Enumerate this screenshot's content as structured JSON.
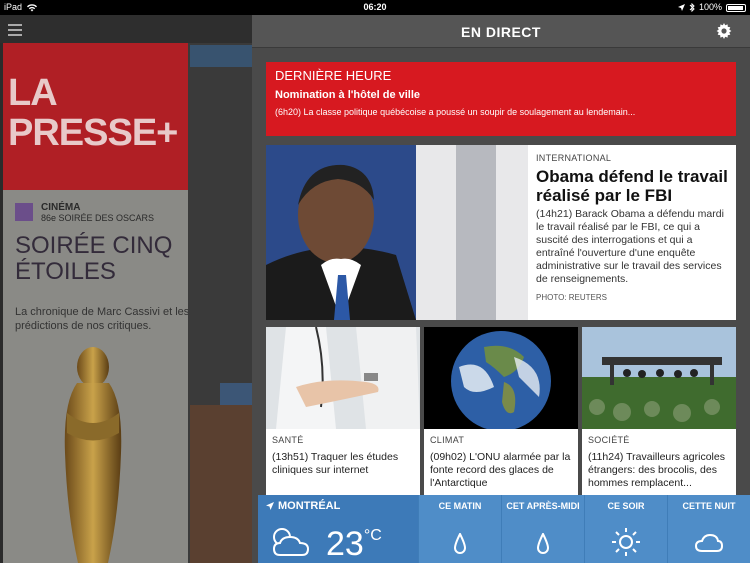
{
  "status_bar": {
    "device": "iPad",
    "time": "06:20",
    "battery": "100%"
  },
  "background": {
    "logo_text": "LA\nPRESSE+",
    "cover_section_title": "CINÉMA",
    "cover_section_subtitle": "86e SOIRÉE DES OSCARS",
    "cover_headline": "SOIRÉE CINQ ÉTOILES",
    "cover_deck": "La chronique de Marc Cassivi et les prédictions de nos critiques."
  },
  "panel": {
    "title": "EN DIRECT",
    "breaking": {
      "label": "DERNIÈRE HEURE",
      "title": "Nomination à l'hôtel de ville",
      "summary": "(6h20) La classe politique québécoise a poussé un soupir de soulagement au lendemain..."
    },
    "feature": {
      "kicker": "INTERNATIONAL",
      "headline": "Obama défend le travail réalisé par le FBI",
      "summary": "(14h21) Barack Obama a défendu mardi le travail réalisé par le FBI, ce qui a suscité des interrogations et qui a entraîné l'ouverture d'une enquête administrative sur le travail des services de renseignements.",
      "credit": "PHOTO: REUTERS"
    },
    "cards": [
      {
        "kicker": "SANTÉ",
        "summary": "(13h51) Traquer les études cliniques sur internet"
      },
      {
        "kicker": "CLIMAT",
        "summary": "(09h02) L'ONU alarmée par la fonte record des glaces de l'Antarctique"
      },
      {
        "kicker": "SOCIÉTÉ",
        "summary": "(11h24) Travailleurs agricoles étrangers: des brocolis, des hommes remplacent..."
      }
    ]
  },
  "weather": {
    "city": "MONTRÉAL",
    "temperature": "23",
    "unit": "°C",
    "periods": [
      "CE MATIN",
      "CET APRÈS-MIDI",
      "CE SOIR",
      "CETTE NUIT"
    ],
    "icons": [
      "partly-cloudy-icon",
      "raindrop-icon",
      "raindrop-icon",
      "sun-icon",
      "cloud-icon"
    ]
  }
}
